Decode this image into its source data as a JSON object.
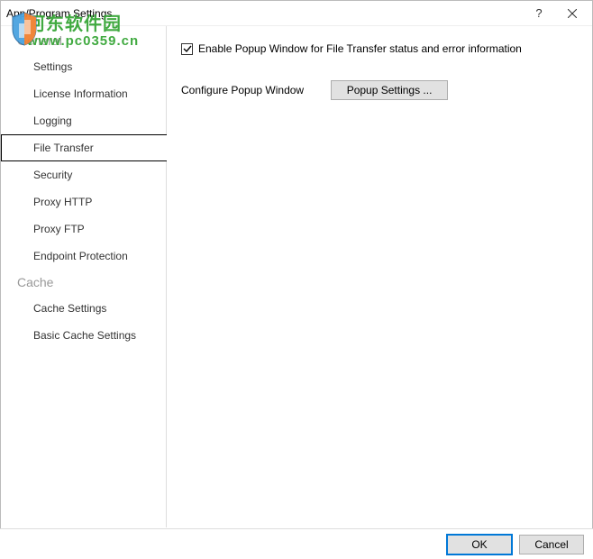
{
  "window": {
    "title": "App/Program Settings",
    "help_symbol": "?",
    "close_symbol": "✕"
  },
  "watermark": {
    "line1": "河东软件园",
    "line2": "www.pc0359.cn"
  },
  "sidebar": {
    "categories": [
      {
        "label": "General",
        "items": [
          {
            "label": "Settings",
            "selected": false
          },
          {
            "label": "License Information",
            "selected": false
          },
          {
            "label": "Logging",
            "selected": false
          },
          {
            "label": "File Transfer",
            "selected": true
          },
          {
            "label": "Security",
            "selected": false
          },
          {
            "label": "Proxy HTTP",
            "selected": false
          },
          {
            "label": "Proxy FTP",
            "selected": false
          },
          {
            "label": "Endpoint Protection",
            "selected": false
          }
        ]
      },
      {
        "label": "Cache",
        "items": [
          {
            "label": "Cache Settings",
            "selected": false
          },
          {
            "label": "Basic Cache Settings",
            "selected": false
          }
        ]
      }
    ]
  },
  "content": {
    "enable_checkbox": {
      "checked": true,
      "label": "Enable Popup Window for File Transfer status and error information"
    },
    "configure_label": "Configure Popup Window",
    "popup_button": "Popup Settings ..."
  },
  "footer": {
    "ok": "OK",
    "cancel": "Cancel"
  }
}
